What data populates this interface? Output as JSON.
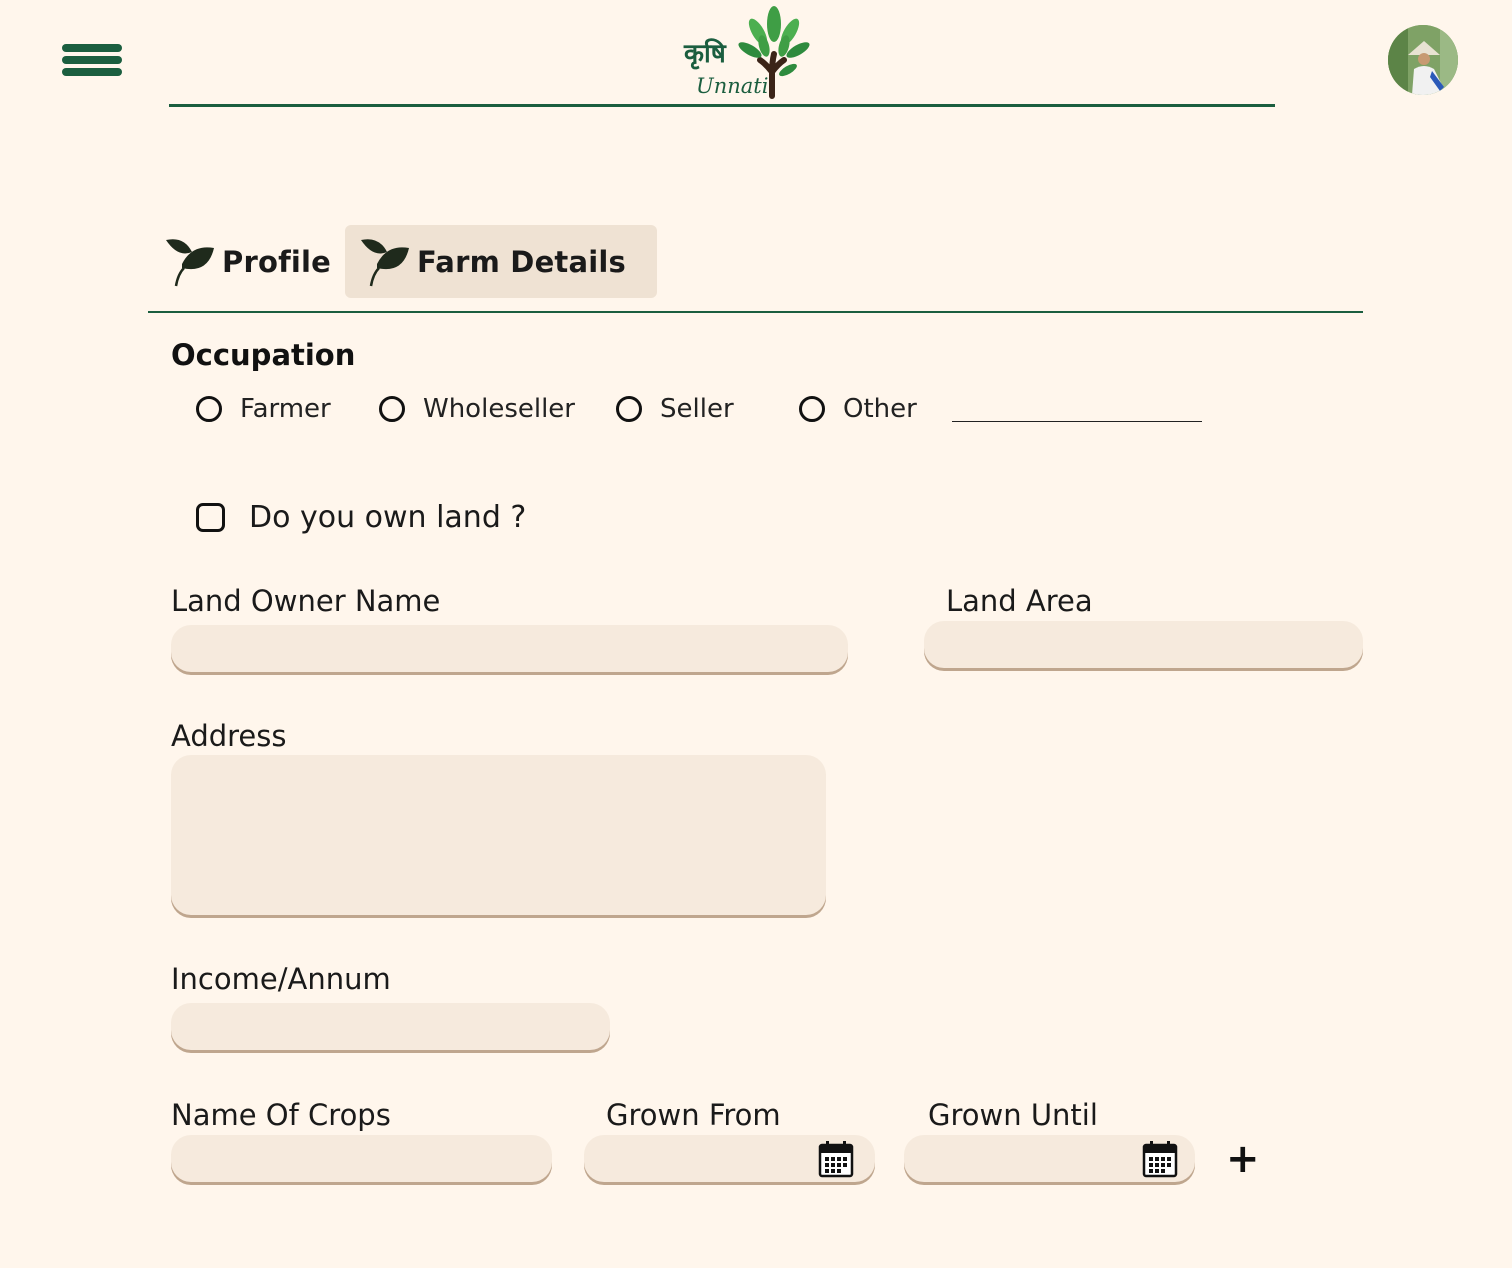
{
  "header": {
    "logo_hindi": "कृषि",
    "logo_text": "Unnati"
  },
  "tabs": [
    {
      "label": "Profile",
      "active": false
    },
    {
      "label": "Farm Details",
      "active": true
    }
  ],
  "occupation": {
    "title": "Occupation",
    "options": [
      "Farmer",
      "Wholeseller",
      "Seller",
      "Other"
    ],
    "other_value": ""
  },
  "land_ownership": {
    "label": "Do you own land ?",
    "checked": false
  },
  "fields": {
    "land_owner_name": {
      "label": "Land Owner Name",
      "value": ""
    },
    "land_area": {
      "label": "Land Area",
      "value": ""
    },
    "address": {
      "label": "Address",
      "value": ""
    },
    "income": {
      "label": "Income/Annum",
      "value": ""
    },
    "crops": {
      "label": "Name Of Crops",
      "value": ""
    },
    "grown_from": {
      "label": "Grown From",
      "value": ""
    },
    "grown_until": {
      "label": "Grown Until",
      "value": ""
    }
  },
  "add_button": "+",
  "colors": {
    "background": "#fff6ec",
    "accent_green": "#1b5e3f",
    "leaf_green": "#3f9e45",
    "input_fill": "#f6eadd",
    "input_underline": "#bfa68e",
    "active_tab": "#efe2d3"
  },
  "icons": {
    "menu": "hamburger-icon",
    "tab": "leaf-icon",
    "calendar": "calendar-icon",
    "add": "plus-icon"
  }
}
